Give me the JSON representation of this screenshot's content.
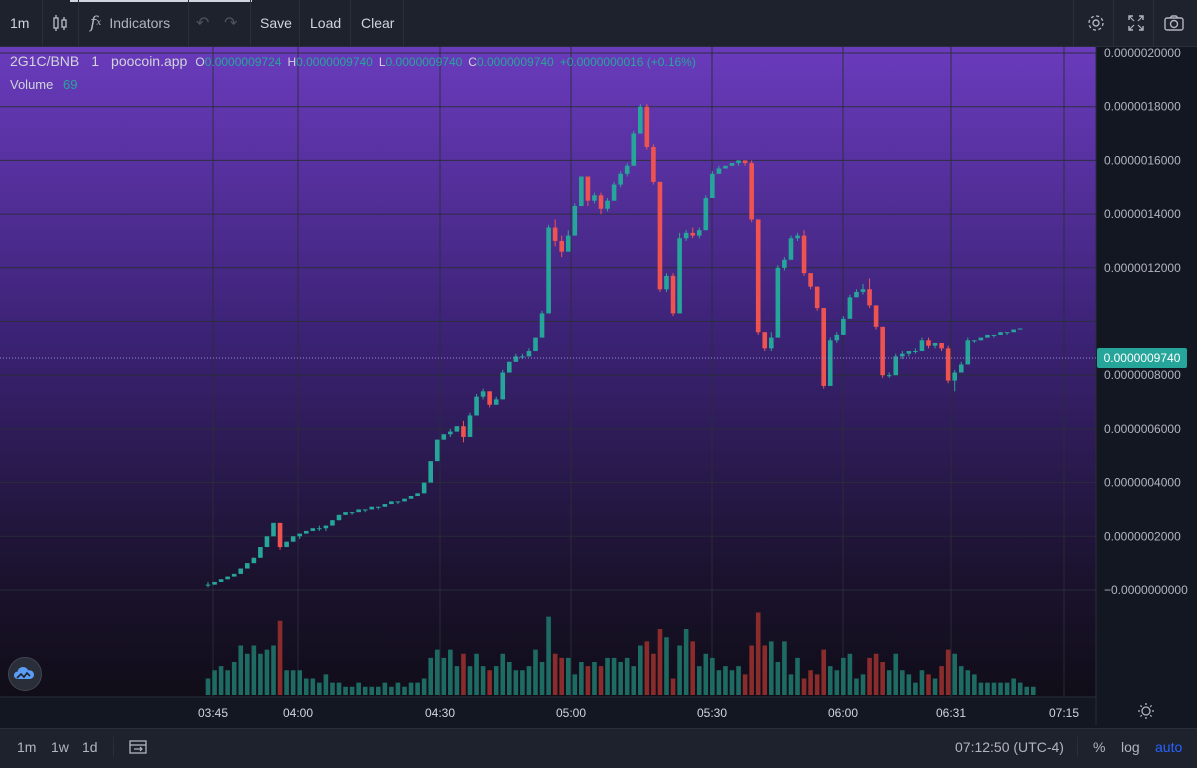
{
  "toolbar": {
    "interval": "1m",
    "indicators_label": "Indicators",
    "save_label": "Save",
    "load_label": "Load",
    "clear_label": "Clear"
  },
  "legend": {
    "symbol": "2G1C/BNB",
    "interval": "1",
    "source": "poocoin.app",
    "open_label": "O",
    "open": "0.0000009724",
    "high_label": "H",
    "high": "0.0000009740",
    "low_label": "L",
    "low": "0.0000009740",
    "close_label": "C",
    "close": "0.0000009740",
    "change": "+0.0000000016 (+0.16%)",
    "volume_label": "Volume",
    "volume_value": "69"
  },
  "price_axis": {
    "labels": [
      "0.0000020000",
      "0.0000018000",
      "0.0000016000",
      "0.0000014000",
      "0.0000012000",
      "0.0000008000",
      "0.0000006000",
      "0.0000004000",
      "0.0000002000",
      "−0.0000000000"
    ],
    "current_price": "0.0000009740"
  },
  "time_axis": {
    "labels": [
      "03:45",
      "04:00",
      "04:30",
      "05:00",
      "05:30",
      "06:00",
      "06:31",
      "07:15"
    ]
  },
  "bottom": {
    "ranges": [
      "1m",
      "1w",
      "1d"
    ],
    "clock": "07:12:50 (UTC-4)",
    "percent": "%",
    "log": "log",
    "auto": "auto"
  },
  "colors": {
    "up": "#26a69a",
    "down": "#ef5350",
    "bg_top": "#6a3bbd",
    "bg_bottom": "#13101e",
    "accent": "#2962ff"
  },
  "chart_data": {
    "type": "candlestick",
    "y_unit": "BNB",
    "ylim": [
      -1.5e-07,
      2e-06
    ],
    "x_start": "03:44",
    "x_step_minutes": 1,
    "candles": [
      [
        2e-08,
        3e-08,
        1e-08,
        2e-08
      ],
      [
        2e-08,
        3e-08,
        2e-08,
        3e-08
      ],
      [
        3e-08,
        4e-08,
        3e-08,
        4e-08
      ],
      [
        4e-08,
        5e-08,
        4e-08,
        5e-08
      ],
      [
        5e-08,
        6e-08,
        5e-08,
        6e-08
      ],
      [
        6e-08,
        8e-08,
        6e-08,
        8e-08
      ],
      [
        8e-08,
        1e-07,
        8e-08,
        1e-07
      ],
      [
        1e-07,
        1.2e-07,
        1e-07,
        1.2e-07
      ],
      [
        1.2e-07,
        1.6e-07,
        1.2e-07,
        1.6e-07
      ],
      [
        1.6e-07,
        2e-07,
        1.6e-07,
        2e-07
      ],
      [
        2e-07,
        2.5e-07,
        2e-07,
        2.5e-07
      ],
      [
        2.5e-07,
        2.5e-07,
        1.5e-07,
        1.6e-07
      ],
      [
        1.6e-07,
        1.8e-07,
        1.6e-07,
        1.8e-07
      ],
      [
        1.8e-07,
        2e-07,
        1.8e-07,
        2e-07
      ],
      [
        2e-07,
        2.1e-07,
        1.9e-07,
        2.1e-07
      ],
      [
        2.1e-07,
        2.2e-07,
        2.1e-07,
        2.2e-07
      ],
      [
        2.2e-07,
        2.3e-07,
        2.2e-07,
        2.3e-07
      ],
      [
        2.3e-07,
        2.4e-07,
        2.2e-07,
        2.3e-07
      ],
      [
        2.3e-07,
        2.4e-07,
        2.2e-07,
        2.4e-07
      ],
      [
        2.4e-07,
        2.6e-07,
        2.4e-07,
        2.6e-07
      ],
      [
        2.6e-07,
        2.8e-07,
        2.6e-07,
        2.8e-07
      ],
      [
        2.8e-07,
        2.9e-07,
        2.8e-07,
        2.9e-07
      ],
      [
        2.9e-07,
        2.9e-07,
        2.8e-07,
        2.9e-07
      ],
      [
        2.9e-07,
        3e-07,
        2.9e-07,
        3e-07
      ],
      [
        3e-07,
        3e-07,
        2.9e-07,
        3e-07
      ],
      [
        3e-07,
        3.1e-07,
        3e-07,
        3.1e-07
      ],
      [
        3.1e-07,
        3.1e-07,
        3e-07,
        3.1e-07
      ],
      [
        3.1e-07,
        3.2e-07,
        3.1e-07,
        3.2e-07
      ],
      [
        3.2e-07,
        3.3e-07,
        3.2e-07,
        3.3e-07
      ],
      [
        3.3e-07,
        3.3e-07,
        3.2e-07,
        3.3e-07
      ],
      [
        3.3e-07,
        3.4e-07,
        3.3e-07,
        3.4e-07
      ],
      [
        3.4e-07,
        3.5e-07,
        3.4e-07,
        3.5e-07
      ],
      [
        3.5e-07,
        3.6e-07,
        3.5e-07,
        3.6e-07
      ],
      [
        3.6e-07,
        4e-07,
        3.6e-07,
        4e-07
      ],
      [
        4e-07,
        4.8e-07,
        4e-07,
        4.8e-07
      ],
      [
        4.8e-07,
        5.6e-07,
        4.8e-07,
        5.6e-07
      ],
      [
        5.6e-07,
        5.8e-07,
        5.6e-07,
        5.8e-07
      ],
      [
        5.8e-07,
        6e-07,
        5.7e-07,
        5.9e-07
      ],
      [
        5.9e-07,
        6.1e-07,
        5.9e-07,
        6.1e-07
      ],
      [
        6.1e-07,
        6.3e-07,
        5.5e-07,
        5.7e-07
      ],
      [
        5.7e-07,
        6.6e-07,
        5.7e-07,
        6.5e-07
      ],
      [
        6.5e-07,
        7.3e-07,
        6.5e-07,
        7.2e-07
      ],
      [
        7.2e-07,
        7.5e-07,
        7.1e-07,
        7.4e-07
      ],
      [
        7.4e-07,
        7.4e-07,
        6.8e-07,
        6.9e-07
      ],
      [
        6.9e-07,
        7.2e-07,
        6.9e-07,
        7.1e-07
      ],
      [
        7.1e-07,
        8.2e-07,
        7.1e-07,
        8.1e-07
      ],
      [
        8.1e-07,
        8.5e-07,
        8.1e-07,
        8.5e-07
      ],
      [
        8.5e-07,
        8.8e-07,
        8.5e-07,
        8.7e-07
      ],
      [
        8.7e-07,
        8.8e-07,
        8.6e-07,
        8.7e-07
      ],
      [
        8.7e-07,
        9e-07,
        8.7e-07,
        8.9e-07
      ],
      [
        8.9e-07,
        9.4e-07,
        8.9e-07,
        9.4e-07
      ],
      [
        9.4e-07,
        1.04e-06,
        9.4e-07,
        1.03e-06
      ],
      [
        1.03e-06,
        1.36e-06,
        1.03e-06,
        1.35e-06
      ],
      [
        1.35e-06,
        1.38e-06,
        1.28e-06,
        1.3e-06
      ],
      [
        1.3e-06,
        1.32e-06,
        1.24e-06,
        1.26e-06
      ],
      [
        1.26e-06,
        1.34e-06,
        1.26e-06,
        1.32e-06
      ],
      [
        1.32e-06,
        1.44e-06,
        1.32e-06,
        1.43e-06
      ],
      [
        1.43e-06,
        1.54e-06,
        1.43e-06,
        1.54e-06
      ],
      [
        1.54e-06,
        1.54e-06,
        1.43e-06,
        1.45e-06
      ],
      [
        1.45e-06,
        1.48e-06,
        1.44e-06,
        1.47e-06
      ],
      [
        1.47e-06,
        1.48e-06,
        1.4e-06,
        1.42e-06
      ],
      [
        1.42e-06,
        1.46e-06,
        1.41e-06,
        1.45e-06
      ],
      [
        1.45e-06,
        1.52e-06,
        1.45e-06,
        1.51e-06
      ],
      [
        1.51e-06,
        1.56e-06,
        1.5e-06,
        1.55e-06
      ],
      [
        1.55e-06,
        1.59e-06,
        1.54e-06,
        1.58e-06
      ],
      [
        1.58e-06,
        1.71e-06,
        1.58e-06,
        1.7e-06
      ],
      [
        1.7e-06,
        1.81e-06,
        1.7e-06,
        1.8e-06
      ],
      [
        1.8e-06,
        1.81e-06,
        1.64e-06,
        1.65e-06
      ],
      [
        1.65e-06,
        1.66e-06,
        1.51e-06,
        1.52e-06
      ],
      [
        1.52e-06,
        1.52e-06,
        1.11e-06,
        1.12e-06
      ],
      [
        1.12e-06,
        1.18e-06,
        1.11e-06,
        1.17e-06
      ],
      [
        1.17e-06,
        1.18e-06,
        1.02e-06,
        1.03e-06
      ],
      [
        1.03e-06,
        1.33e-06,
        1.03e-06,
        1.31e-06
      ],
      [
        1.31e-06,
        1.34e-06,
        1.3e-06,
        1.33e-06
      ],
      [
        1.33e-06,
        1.35e-06,
        1.31e-06,
        1.32e-06
      ],
      [
        1.32e-06,
        1.35e-06,
        1.31e-06,
        1.34e-06
      ],
      [
        1.34e-06,
        1.47e-06,
        1.34e-06,
        1.46e-06
      ],
      [
        1.46e-06,
        1.56e-06,
        1.46e-06,
        1.55e-06
      ],
      [
        1.55e-06,
        1.58e-06,
        1.55e-06,
        1.57e-06
      ],
      [
        1.57e-06,
        1.58e-06,
        1.57e-06,
        1.58e-06
      ],
      [
        1.58e-06,
        1.59e-06,
        1.58e-06,
        1.59e-06
      ],
      [
        1.59e-06,
        1.6e-06,
        1.58e-06,
        1.6e-06
      ],
      [
        1.6e-06,
        1.6e-06,
        1.58e-06,
        1.59e-06
      ],
      [
        1.59e-06,
        1.6e-06,
        1.37e-06,
        1.38e-06
      ],
      [
        1.38e-06,
        1.38e-06,
        9.5e-07,
        9.6e-07
      ],
      [
        9.6e-07,
        9.6e-07,
        8.9e-07,
        9e-07
      ],
      [
        9e-07,
        9.6e-07,
        8.9e-07,
        9.4e-07
      ],
      [
        9.4e-07,
        1.21e-06,
        9.4e-07,
        1.2e-06
      ],
      [
        1.2e-06,
        1.24e-06,
        1.19e-06,
        1.23e-06
      ],
      [
        1.23e-06,
        1.32e-06,
        1.23e-06,
        1.31e-06
      ],
      [
        1.31e-06,
        1.33e-06,
        1.3e-06,
        1.32e-06
      ],
      [
        1.32e-06,
        1.34e-06,
        1.17e-06,
        1.18e-06
      ],
      [
        1.18e-06,
        1.18e-06,
        1.12e-06,
        1.13e-06
      ],
      [
        1.13e-06,
        1.13e-06,
        1.04e-06,
        1.05e-06
      ],
      [
        1.05e-06,
        1.05e-06,
        7.5e-07,
        7.6e-07
      ],
      [
        7.6e-07,
        9.4e-07,
        7.6e-07,
        9.3e-07
      ],
      [
        9.3e-07,
        9.6e-07,
        9.2e-07,
        9.5e-07
      ],
      [
        9.5e-07,
        1.02e-06,
        9.5e-07,
        1.01e-06
      ],
      [
        1.01e-06,
        1.1e-06,
        1.01e-06,
        1.09e-06
      ],
      [
        1.09e-06,
        1.12e-06,
        1.09e-06,
        1.11e-06
      ],
      [
        1.11e-06,
        1.14e-06,
        1.1e-06,
        1.12e-06
      ],
      [
        1.12e-06,
        1.16e-06,
        1.05e-06,
        1.06e-06
      ],
      [
        1.06e-06,
        1.06e-06,
        9.7e-07,
        9.8e-07
      ],
      [
        9.8e-07,
        9.8e-07,
        7.9e-07,
        8e-07
      ],
      [
        8e-07,
        8.1e-07,
        7.9e-07,
        8e-07
      ],
      [
        8e-07,
        8.8e-07,
        8e-07,
        8.7e-07
      ],
      [
        8.7e-07,
        8.9e-07,
        8.6e-07,
        8.8e-07
      ],
      [
        8.8e-07,
        8.9e-07,
        8.7e-07,
        8.9e-07
      ],
      [
        8.9e-07,
        9e-07,
        8.8e-07,
        8.9e-07
      ],
      [
        8.9e-07,
        9.4e-07,
        8.9e-07,
        9.3e-07
      ],
      [
        9.3e-07,
        9.4e-07,
        9e-07,
        9.1e-07
      ],
      [
        9.1e-07,
        9.2e-07,
        9e-07,
        9.2e-07
      ],
      [
        9.2e-07,
        9.2e-07,
        8.9e-07,
        9e-07
      ],
      [
        9e-07,
        9.1e-07,
        7.7e-07,
        7.8e-07
      ],
      [
        7.8e-07,
        8.2e-07,
        7.4e-07,
        8.1e-07
      ],
      [
        8.1e-07,
        8.5e-07,
        8.1e-07,
        8.4e-07
      ],
      [
        8.4e-07,
        9.4e-07,
        8.4e-07,
        9.3e-07
      ],
      [
        9.3e-07,
        9.3e-07,
        9.2e-07,
        9.3e-07
      ],
      [
        9.3e-07,
        9.4e-07,
        9.3e-07,
        9.4e-07
      ],
      [
        9.4e-07,
        9.5e-07,
        9.4e-07,
        9.5e-07
      ],
      [
        9.5e-07,
        9.5e-07,
        9.4e-07,
        9.5e-07
      ],
      [
        9.5e-07,
        9.6e-07,
        9.5e-07,
        9.6e-07
      ],
      [
        9.6e-07,
        9.6e-07,
        9.5e-07,
        9.6e-07
      ],
      [
        9.6e-07,
        9.7e-07,
        9.6e-07,
        9.7e-07
      ],
      [
        9.7e-07,
        9.74e-07,
        9.7e-07,
        9.74e-07
      ]
    ],
    "volume": [
      4,
      6,
      7,
      6,
      8,
      12,
      10,
      12,
      10,
      11,
      12,
      18,
      6,
      6,
      6,
      4,
      4,
      3,
      5,
      3,
      3,
      2,
      2,
      3,
      2,
      2,
      2,
      3,
      2,
      3,
      2,
      3,
      3,
      4,
      9,
      11,
      9,
      11,
      7,
      10,
      7,
      10,
      7,
      6,
      7,
      10,
      8,
      6,
      6,
      7,
      11,
      8,
      19,
      10,
      9,
      9,
      5,
      8,
      7,
      8,
      7,
      9,
      9,
      8,
      9,
      7,
      12,
      13,
      10,
      16,
      14,
      4,
      12,
      16,
      13,
      7,
      10,
      9,
      6,
      7,
      6,
      7,
      5,
      12,
      20,
      12,
      13,
      8,
      13,
      5,
      9,
      4,
      6,
      5,
      11,
      7,
      6,
      9,
      10,
      4,
      5,
      9,
      10,
      8,
      6,
      10,
      6,
      5,
      3,
      6,
      5,
      4,
      7,
      11,
      10,
      7,
      6,
      5,
      3,
      3,
      3,
      3,
      3,
      4,
      3,
      2,
      2
    ],
    "volume_down_indices": [
      11,
      39,
      43,
      53,
      54,
      60,
      67,
      68,
      69,
      71,
      83,
      84,
      85,
      91,
      92,
      93,
      94,
      101,
      102,
      103,
      112,
      113
    ],
    "volume_max": 40
  }
}
